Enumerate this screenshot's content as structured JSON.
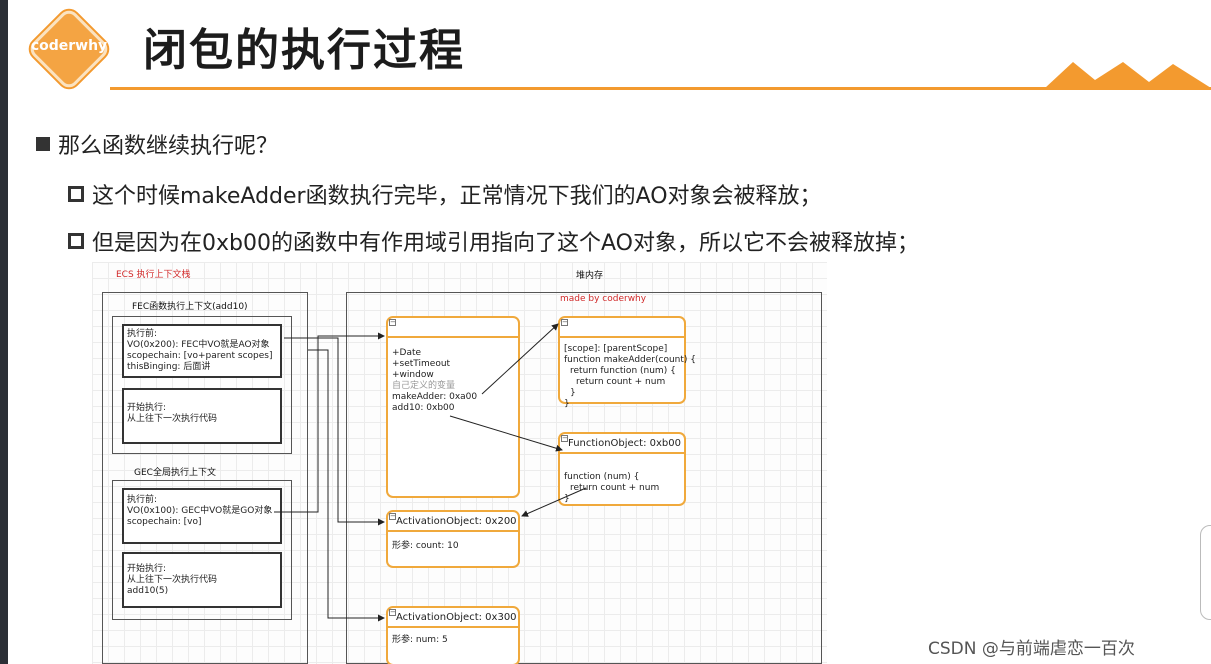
{
  "header": {
    "logo_text": "coderwhy",
    "title": "闭包的执行过程",
    "accent_color": "#f39a2f"
  },
  "bullets": {
    "main": "那么函数继续执行呢？",
    "sub1": "这个时候makeAdder函数执行完毕，正常情况下我们的AO对象会被释放；",
    "sub2": "但是因为在0xb00的函数中有作用域引用指向了这个AO对象，所以它不会被释放掉；"
  },
  "diagram": {
    "ecs_title": "ECS 执行上下文栈",
    "heap_title": "堆内存",
    "made_by": "made by coderwhy",
    "fec_title": "FEC函数执行上下文(add10)",
    "fec_before": [
      "执行前:",
      "VO(0x200): FEC中VO就是AO对象",
      "scopechain: [vo+parent scopes]",
      "thisBinging: 后面讲"
    ],
    "fec_after": [
      "开始执行:",
      "从上往下一次执行代码"
    ],
    "gec_title": "GEC全局执行上下文",
    "gec_before": [
      "执行前:",
      "VO(0x100): GEC中VO就是GO对象",
      "scopechain: [vo]"
    ],
    "gec_after": [
      "开始执行:",
      "从上往下一次执行代码",
      "add10(5)"
    ],
    "go_lines": [
      "+Date",
      "+setTimeout",
      "+window",
      "自己定义的变量",
      "makeAdder: 0xa00",
      "add10: 0xb00"
    ],
    "fo_a00_lines": [
      "[scope]: [parentScope]",
      "function makeAdder(count) {",
      "  return function (num) {",
      "    return count + num",
      "  }",
      "}"
    ],
    "fo_b00_title": "FunctionObject: 0xb00",
    "fo_b00_lines": [
      "function (num) {",
      "  return count + num",
      "}"
    ],
    "ao200_title": "ActivationObject: 0x200",
    "ao200_lines": [
      "形参: count: 10"
    ],
    "ao300_title": "ActivationObject: 0x300",
    "ao300_lines": [
      "形参: num: 5"
    ],
    "minus_glyph": "−"
  },
  "watermark": "CSDN @与前端虐恋一百次"
}
